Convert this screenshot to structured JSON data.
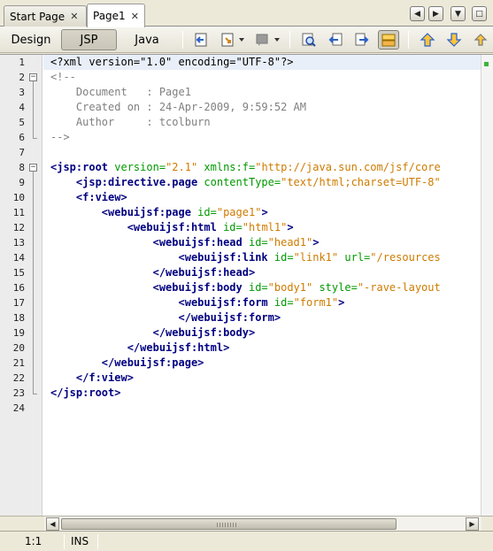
{
  "tabs": [
    {
      "label": "Start Page",
      "close": "✕"
    },
    {
      "label": "Page1",
      "close": "✕"
    }
  ],
  "tab_nav": {
    "left": "◀",
    "right": "▶",
    "menu": "▼",
    "maximize": "□"
  },
  "toolbar": {
    "views": [
      "Design",
      "JSP",
      "Java"
    ],
    "selected_view": "JSP",
    "icons": [
      "back-history-icon",
      "last-edit-icon",
      "bookmark-icon",
      "find-icon",
      "find-previous-icon",
      "find-next-icon",
      "toggle-highlight-icon",
      "previous-occurrence-icon",
      "next-occurrence-icon",
      "toggle-bookmark-icon"
    ]
  },
  "editor": {
    "line_numbers": [
      "1",
      "2",
      "3",
      "4",
      "5",
      "6",
      "7",
      "8",
      "9",
      "10",
      "11",
      "12",
      "13",
      "14",
      "15",
      "16",
      "17",
      "18",
      "19",
      "20",
      "21",
      "22",
      "23",
      "24"
    ],
    "current_line": 1,
    "lines": [
      [
        {
          "t": "pi",
          "s": "<?xml version=\"1.0\" encoding=\"UTF-8\"?>"
        }
      ],
      [
        {
          "t": "cmt",
          "s": "<!--"
        }
      ],
      [
        {
          "t": "cmt",
          "s": "    Document   : Page1"
        }
      ],
      [
        {
          "t": "cmt",
          "s": "    Created on : 24-Apr-2009, 9:59:52 AM"
        }
      ],
      [
        {
          "t": "cmt",
          "s": "    Author     : tcolburn"
        }
      ],
      [
        {
          "t": "cmt",
          "s": "-->"
        }
      ],
      [],
      [
        {
          "t": "tag",
          "s": "<jsp:root"
        },
        {
          "t": "attr",
          "s": " version="
        },
        {
          "t": "val",
          "s": "\"2.1\""
        },
        {
          "t": "attr",
          "s": " xmlns:f="
        },
        {
          "t": "val",
          "s": "\"http://java.sun.com/jsf/core"
        }
      ],
      [
        {
          "t": "plain",
          "s": "    "
        },
        {
          "t": "tag",
          "s": "<jsp:directive.page"
        },
        {
          "t": "attr",
          "s": " contentType="
        },
        {
          "t": "val",
          "s": "\"text/html;charset=UTF-8\""
        }
      ],
      [
        {
          "t": "plain",
          "s": "    "
        },
        {
          "t": "tag",
          "s": "<f:view>"
        }
      ],
      [
        {
          "t": "plain",
          "s": "        "
        },
        {
          "t": "tag",
          "s": "<webuijsf:page"
        },
        {
          "t": "attr",
          "s": " id="
        },
        {
          "t": "val",
          "s": "\"page1\""
        },
        {
          "t": "tag",
          "s": ">"
        }
      ],
      [
        {
          "t": "plain",
          "s": "            "
        },
        {
          "t": "tag",
          "s": "<webuijsf:html"
        },
        {
          "t": "attr",
          "s": " id="
        },
        {
          "t": "val",
          "s": "\"html1\""
        },
        {
          "t": "tag",
          "s": ">"
        }
      ],
      [
        {
          "t": "plain",
          "s": "                "
        },
        {
          "t": "tag",
          "s": "<webuijsf:head"
        },
        {
          "t": "attr",
          "s": " id="
        },
        {
          "t": "val",
          "s": "\"head1\""
        },
        {
          "t": "tag",
          "s": ">"
        }
      ],
      [
        {
          "t": "plain",
          "s": "                    "
        },
        {
          "t": "tag",
          "s": "<webuijsf:link"
        },
        {
          "t": "attr",
          "s": " id="
        },
        {
          "t": "val",
          "s": "\"link1\""
        },
        {
          "t": "attr",
          "s": " url="
        },
        {
          "t": "val",
          "s": "\"/resources"
        }
      ],
      [
        {
          "t": "plain",
          "s": "                "
        },
        {
          "t": "tag",
          "s": "</webuijsf:head>"
        }
      ],
      [
        {
          "t": "plain",
          "s": "                "
        },
        {
          "t": "tag",
          "s": "<webuijsf:body"
        },
        {
          "t": "attr",
          "s": " id="
        },
        {
          "t": "val",
          "s": "\"body1\""
        },
        {
          "t": "attr",
          "s": " style="
        },
        {
          "t": "val",
          "s": "\"-rave-layout"
        }
      ],
      [
        {
          "t": "plain",
          "s": "                    "
        },
        {
          "t": "tag",
          "s": "<webuijsf:form"
        },
        {
          "t": "attr",
          "s": " id="
        },
        {
          "t": "val",
          "s": "\"form1\""
        },
        {
          "t": "tag",
          "s": ">"
        }
      ],
      [
        {
          "t": "plain",
          "s": "                    "
        },
        {
          "t": "tag",
          "s": "</webuijsf:form>"
        }
      ],
      [
        {
          "t": "plain",
          "s": "                "
        },
        {
          "t": "tag",
          "s": "</webuijsf:body>"
        }
      ],
      [
        {
          "t": "plain",
          "s": "            "
        },
        {
          "t": "tag",
          "s": "</webuijsf:html>"
        }
      ],
      [
        {
          "t": "plain",
          "s": "        "
        },
        {
          "t": "tag",
          "s": "</webuijsf:page>"
        }
      ],
      [
        {
          "t": "plain",
          "s": "    "
        },
        {
          "t": "tag",
          "s": "</f:view>"
        }
      ],
      [
        {
          "t": "tag",
          "s": "</jsp:root>"
        }
      ],
      []
    ]
  },
  "status": {
    "position": "1:1",
    "mode": "INS"
  }
}
